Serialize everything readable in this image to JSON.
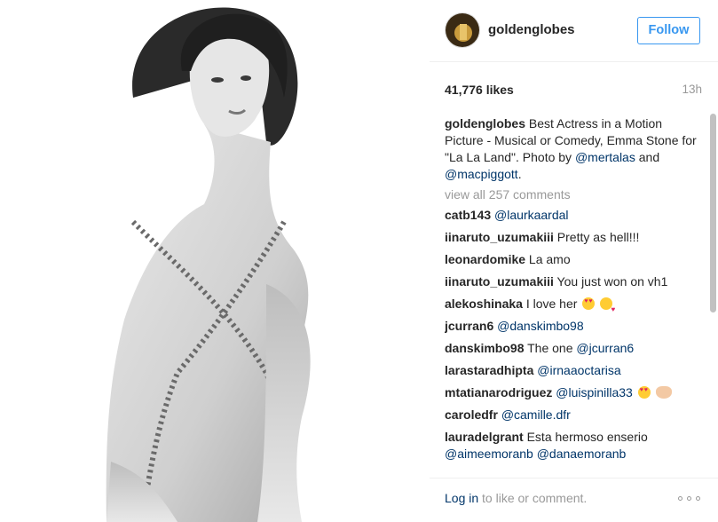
{
  "post": {
    "photo_alt": "Black and white portrait photo",
    "author": "goldenglobes",
    "follow_label": "Follow",
    "likes": "41,776 likes",
    "time": "13h",
    "caption": {
      "user": "goldenglobes",
      "text": " Best Actress in a Motion Picture - Musical or Comedy, Emma Stone for \"La La Land\". Photo by ",
      "mention1": "@mertalas",
      "and": " and ",
      "mention2": "@macpiggott",
      "end": "."
    },
    "view_all": "view all 257 comments"
  },
  "comments": [
    {
      "user": "catb143",
      "mention": "@laurkaardal",
      "text": "",
      "emoji": []
    },
    {
      "user": "iinaruto_uzumakiii",
      "mention": "",
      "text": " Pretty as hell!!!",
      "emoji": []
    },
    {
      "user": "leonardomike",
      "mention": "",
      "text": " La amo",
      "emoji": []
    },
    {
      "user": "iinaruto_uzumakiii",
      "mention": "",
      "text": " You just won on vh1",
      "emoji": []
    },
    {
      "user": "alekoshinaka",
      "mention": "",
      "text": " I love her",
      "emoji": [
        "heart-eyes-icon",
        "kiss-icon"
      ]
    },
    {
      "user": "jcurran6",
      "mention": "@danskimbo98",
      "text": "",
      "emoji": []
    },
    {
      "user": "danskimbo98",
      "mention": "@jcurran6",
      "text": " The one ",
      "emoji": []
    },
    {
      "user": "larastaradhipta",
      "mention": "@irnaaoctarisa",
      "text": "",
      "emoji": []
    },
    {
      "user": "mtatianarodriguez",
      "mention": "@luispinilla33",
      "text": "",
      "emoji": [
        "heart-eyes-icon",
        "clap-icon"
      ]
    },
    {
      "user": "caroledfr",
      "mention": "@camille.dfr",
      "text": "",
      "emoji": []
    },
    {
      "user": "lauradelgrant",
      "mention": "",
      "text": " Esta hermoso enserio",
      "emoji": [],
      "mentions_line": [
        "@aimeemoranb",
        "@danaemoranb"
      ]
    }
  ],
  "footer": {
    "login_link": "Log in",
    "login_text": " to like or comment."
  },
  "scroll": {
    "thumb_fraction": 0.56
  },
  "colors": {
    "accent": "#3897f0",
    "link": "#003569",
    "muted": "#999999"
  }
}
